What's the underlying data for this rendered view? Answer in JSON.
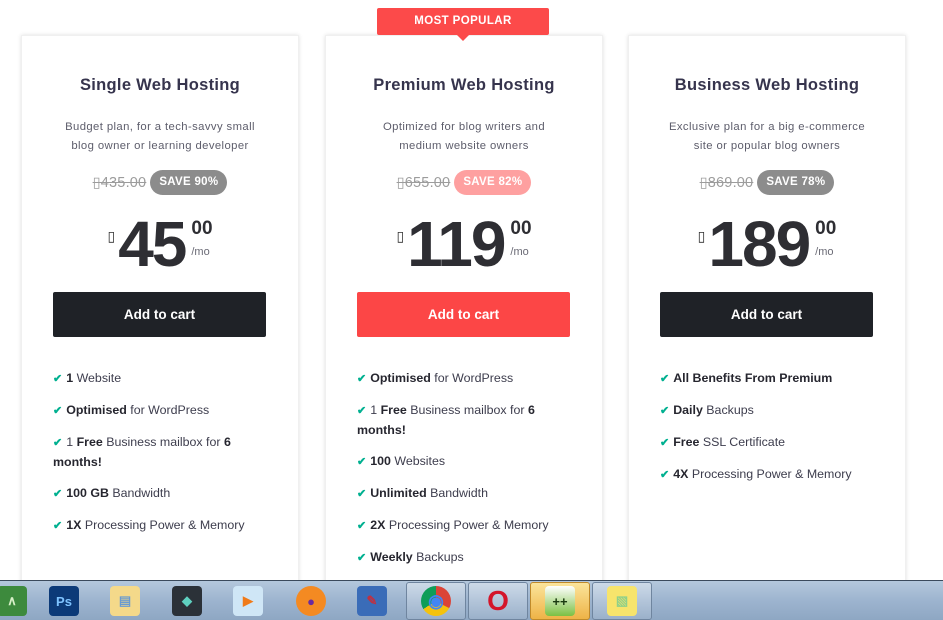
{
  "ribbon": {
    "label": "MOST POPULAR"
  },
  "plans": [
    {
      "title": "Single Web Hosting",
      "desc_line1": "Budget plan, for a tech-savvy small",
      "desc_line2": "blog owner or learning developer",
      "old_price": "▯435.00",
      "save_badge": "SAVE 90%",
      "currency": "▯",
      "amount": "45",
      "cents": "00",
      "per": "/mo",
      "cta": "Add to cart",
      "features": [
        {
          "bold": "1",
          "text": " Website",
          "pre": ""
        },
        {
          "bold": "Optimised",
          "text": " for WordPress",
          "pre": ""
        },
        {
          "pre": "1 ",
          "bold": "Free",
          "text": " Business mailbox for ",
          "bold2": "6 months!"
        },
        {
          "bold": "100 GB",
          "text": " Bandwidth",
          "pre": ""
        },
        {
          "bold": "1X",
          "text": " Processing Power & Memory",
          "pre": ""
        }
      ]
    },
    {
      "title": "Premium Web Hosting",
      "desc_line1": "Optimized for blog writers and",
      "desc_line2": "medium website owners",
      "old_price": "▯655.00",
      "save_badge": "SAVE 82%",
      "currency": "▯",
      "amount": "119",
      "cents": "00",
      "per": "/mo",
      "cta": "Add to cart",
      "features": [
        {
          "bold": "Optimised",
          "text": " for WordPress",
          "pre": ""
        },
        {
          "pre": "1 ",
          "bold": "Free",
          "text": " Business mailbox for ",
          "bold2": "6 months!"
        },
        {
          "bold": "100",
          "text": " Websites",
          "pre": ""
        },
        {
          "bold": "Unlimited",
          "text": " Bandwidth",
          "pre": ""
        },
        {
          "bold": "2X",
          "text": " Processing Power & Memory",
          "pre": ""
        },
        {
          "bold": "Weekly",
          "text": " Backups",
          "pre": ""
        }
      ]
    },
    {
      "title": "Business Web Hosting",
      "desc_line1": "Exclusive plan for a big e-commerce",
      "desc_line2": "site or popular blog owners",
      "old_price": "▯869.00",
      "save_badge": "SAVE 78%",
      "currency": "▯",
      "amount": "189",
      "cents": "00",
      "per": "/mo",
      "cta": "Add to cart",
      "features": [
        {
          "bold": "All Benefits From Premium",
          "text": "",
          "pre": ""
        },
        {
          "bold": "Daily",
          "text": " Backups",
          "pre": ""
        },
        {
          "bold": "Free",
          "text": " SSL Certificate",
          "pre": ""
        },
        {
          "bold": "4X",
          "text": " Processing Power & Memory",
          "pre": ""
        }
      ]
    }
  ],
  "check_glyph": "✔",
  "colors": {
    "accent_red": "#fc4a4a",
    "dark_button": "#1f2227",
    "check_green": "#00b090",
    "save_gray": "#8c8c8c",
    "save_pink": "#fea0a0"
  },
  "taskbar": {
    "items": [
      {
        "name": "coreldraw-icon",
        "glyph": "∧"
      },
      {
        "name": "photoshop-icon",
        "glyph": "Ps"
      },
      {
        "name": "file-explorer-icon",
        "glyph": "▤"
      },
      {
        "name": "filmora-icon",
        "glyph": "◆"
      },
      {
        "name": "media-player-icon",
        "glyph": "▶"
      },
      {
        "name": "firefox-icon",
        "glyph": "●"
      },
      {
        "name": "paint-icon",
        "glyph": "✎"
      },
      {
        "name": "chrome-icon",
        "glyph": "◉"
      },
      {
        "name": "opera-icon",
        "glyph": "O"
      },
      {
        "name": "notepad-plus-plus-icon",
        "glyph": "++"
      },
      {
        "name": "sticky-notes-icon",
        "glyph": "▧"
      }
    ]
  }
}
